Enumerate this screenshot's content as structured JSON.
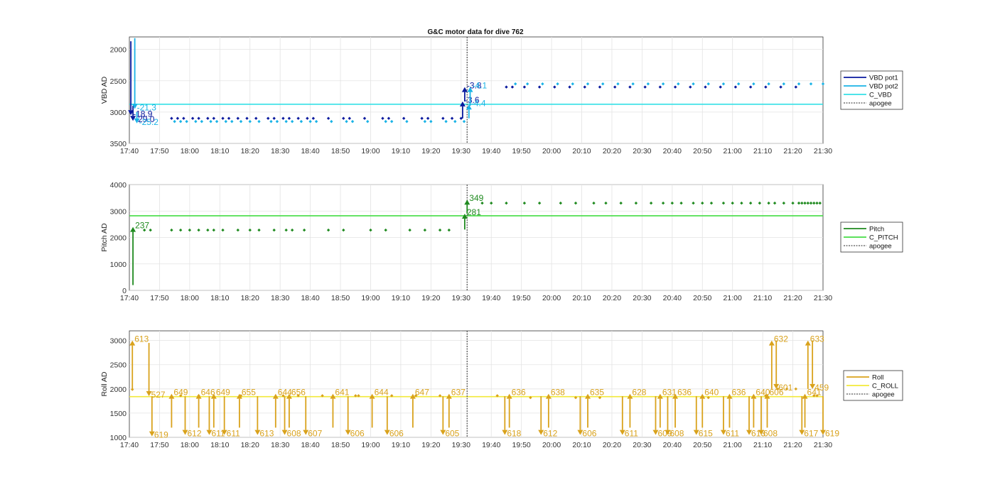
{
  "figure": {
    "title": "G&C motor data for dive 762"
  },
  "x_ticks": [
    "17:40",
    "17:50",
    "18:00",
    "18:10",
    "18:20",
    "18:30",
    "18:40",
    "18:50",
    "19:00",
    "19:10",
    "19:20",
    "19:30",
    "19:40",
    "19:50",
    "20:00",
    "20:10",
    "20:20",
    "20:30",
    "20:40",
    "20:50",
    "21:00",
    "21:10",
    "21:20",
    "21:30"
  ],
  "colors": {
    "vbd_pot1": "#0a1a9e",
    "vbd_pot2": "#1ab3e6",
    "c_vbd": "#35e0e6",
    "pitch": "#1f8a1f",
    "c_pitch": "#44dd44",
    "roll": "#d9a21c",
    "c_roll": "#f2ea3a",
    "apogee": "#555555"
  },
  "chart_data": [
    {
      "type": "scatter",
      "ylabel": "VBD AD",
      "ylim": [
        3500,
        1800
      ],
      "y_reversed": true,
      "yticks": [
        2000,
        2500,
        3000,
        3500
      ],
      "x_unit": "minutes after 17:40",
      "xlim": [
        0,
        230
      ],
      "grid": true,
      "legend_position": "right",
      "legend": [
        "VBD pot1",
        "VBD pot2",
        "C_VBD",
        "apogee"
      ],
      "apogee_x": 112,
      "reference_line": {
        "name": "C_VBD",
        "y": 2875
      },
      "series": [
        {
          "name": "VBD pot1",
          "x": [
            14,
            16,
            18,
            21,
            23,
            26,
            28,
            31,
            33,
            36,
            39,
            42,
            46,
            48,
            51,
            53,
            56,
            59,
            61,
            66,
            71,
            73,
            78,
            84,
            86,
            91,
            97,
            99,
            104,
            107,
            110,
            125,
            127,
            131,
            136,
            141,
            146,
            151,
            156,
            161,
            166,
            171,
            176,
            181,
            186,
            191,
            196,
            201,
            206,
            211,
            216,
            221
          ],
          "y": [
            3100,
            3100,
            3100,
            3100,
            3100,
            3100,
            3100,
            3100,
            3100,
            3100,
            3100,
            3100,
            3100,
            3100,
            3100,
            3100,
            3100,
            3100,
            3100,
            3100,
            3100,
            3100,
            3100,
            3100,
            3100,
            3100,
            3100,
            3100,
            3100,
            3100,
            3100,
            2600,
            2600,
            2600,
            2600,
            2600,
            2600,
            2600,
            2600,
            2600,
            2600,
            2600,
            2600,
            2600,
            2600,
            2600,
            2600,
            2600,
            2600,
            2600,
            2600,
            2600
          ]
        },
        {
          "name": "VBD pot2",
          "x": [
            15,
            17,
            19,
            22,
            24,
            27,
            29,
            32,
            34,
            37,
            40,
            43,
            47,
            49,
            52,
            54,
            57,
            60,
            62,
            67,
            72,
            74,
            79,
            85,
            87,
            92,
            98,
            100,
            105,
            108,
            111,
            128,
            132,
            137,
            142,
            147,
            152,
            157,
            162,
            167,
            172,
            177,
            182,
            187,
            192,
            197,
            202,
            207,
            212,
            217,
            222,
            226,
            230
          ],
          "y": [
            3150,
            3150,
            3150,
            3150,
            3150,
            3150,
            3150,
            3150,
            3150,
            3150,
            3150,
            3150,
            3150,
            3150,
            3150,
            3150,
            3150,
            3150,
            3150,
            3150,
            3150,
            3150,
            3150,
            3150,
            3150,
            3150,
            3150,
            3150,
            3150,
            3150,
            3150,
            2550,
            2550,
            2550,
            2550,
            2550,
            2550,
            2550,
            2550,
            2550,
            2550,
            2550,
            2550,
            2550,
            2550,
            2550,
            2550,
            2550,
            2550,
            2550,
            2550,
            2550,
            2550
          ]
        }
      ],
      "arrows": [
        {
          "series": "VBD pot1",
          "x": 0.5,
          "y_from": 1870,
          "y_to": 3050,
          "label": "-18.9"
        },
        {
          "series": "VBD pot1",
          "x": 1.2,
          "y_from": 2900,
          "y_to": 3140,
          "label": "-29.0"
        },
        {
          "series": "VBD pot2",
          "x": 1.8,
          "y_from": 1820,
          "y_to": 2950,
          "label": "-21.3"
        },
        {
          "series": "VBD pot2",
          "x": 2.5,
          "y_from": 3000,
          "y_to": 3180,
          "label": "-25.2"
        },
        {
          "series": "VBD pot1",
          "x": 110.5,
          "y_from": 3100,
          "y_to": 2830,
          "label": "-3.6"
        },
        {
          "series": "VBD pot1",
          "x": 111.2,
          "y_from": 2830,
          "y_to": 2600,
          "label": "-3.8"
        },
        {
          "series": "VBD pot2",
          "x": 112.6,
          "y_from": 3100,
          "y_to": 2880,
          "label": "-4.4"
        },
        {
          "series": "VBD pot2",
          "x": 113.0,
          "y_from": 2900,
          "y_to": 2600,
          "label": "-4.1"
        }
      ]
    },
    {
      "type": "scatter",
      "ylabel": "Pitch AD",
      "ylim": [
        0,
        4000
      ],
      "yticks": [
        0,
        1000,
        2000,
        3000,
        4000
      ],
      "x_unit": "minutes after 17:40",
      "xlim": [
        0,
        230
      ],
      "grid": true,
      "legend_position": "right",
      "legend": [
        "Pitch",
        "C_PITCH",
        "apogee"
      ],
      "apogee_x": 112,
      "reference_line": {
        "name": "C_PITCH",
        "y": 2820
      },
      "series": [
        {
          "name": "Pitch",
          "x": [
            5,
            7,
            14,
            17,
            20,
            23,
            26,
            28,
            31,
            36,
            40,
            43,
            48,
            52,
            54,
            58,
            66,
            71,
            80,
            85,
            93,
            98,
            103,
            106,
            117,
            120,
            125,
            131,
            136,
            143,
            148,
            154,
            158,
            163,
            168,
            173,
            177,
            180,
            183,
            187,
            190,
            193,
            197,
            200,
            203,
            206,
            209,
            212,
            214,
            217,
            220,
            222,
            223,
            224,
            225,
            226,
            227,
            228,
            229
          ],
          "y": [
            2280,
            2280,
            2280,
            2280,
            2280,
            2280,
            2280,
            2280,
            2280,
            2280,
            2280,
            2280,
            2280,
            2280,
            2280,
            2280,
            2280,
            2280,
            2280,
            2280,
            2280,
            2280,
            2280,
            2280,
            3300,
            3300,
            3300,
            3300,
            3300,
            3300,
            3300,
            3300,
            3300,
            3300,
            3300,
            3300,
            3300,
            3300,
            3300,
            3300,
            3300,
            3300,
            3300,
            3300,
            3300,
            3300,
            3300,
            3300,
            3300,
            3300,
            3300,
            3300,
            3300,
            3300,
            3300,
            3300,
            3300,
            3300,
            3300
          ]
        }
      ],
      "arrows": [
        {
          "series": "Pitch",
          "x": 1.2,
          "y_from": 200,
          "y_to": 2400,
          "label": "237"
        },
        {
          "series": "Pitch",
          "x": 111.2,
          "y_from": 2300,
          "y_to": 2900,
          "label": "281"
        },
        {
          "series": "Pitch",
          "x": 112.0,
          "y_from": 2900,
          "y_to": 3430,
          "label": "349"
        }
      ]
    },
    {
      "type": "scatter",
      "ylabel": "Roll AD",
      "ylim": [
        1000,
        3200
      ],
      "yticks": [
        1000,
        1500,
        2000,
        2500,
        3000
      ],
      "x_unit": "minutes after 17:40",
      "xlim": [
        0,
        230
      ],
      "grid": true,
      "legend_position": "right",
      "legend": [
        "Roll",
        "C_ROLL",
        "apogee"
      ],
      "apogee_x": 112,
      "reference_line": {
        "name": "C_ROLL",
        "y": 1840
      },
      "series": [
        {
          "name": "Roll",
          "x": [
            1,
            17,
            23,
            37,
            51,
            56,
            64,
            75,
            76,
            87,
            95,
            103,
            122,
            133,
            148,
            156,
            192,
            211,
            215,
            218,
            221,
            227,
            228
          ],
          "y": [
            1990,
            1860,
            1860,
            1860,
            1860,
            1860,
            1860,
            1860,
            1860,
            1860,
            1860,
            1860,
            1860,
            1820,
            1820,
            1820,
            1820,
            1860,
            2000,
            2000,
            2000,
            1860,
            1860
          ]
        }
      ],
      "arrows": [
        {
          "series": "Roll",
          "x": 1,
          "y_from": 1990,
          "y_to": 3000,
          "label": "613"
        },
        {
          "series": "Roll",
          "x": 6.5,
          "y_from": 2950,
          "y_to": 1850,
          "label": "527"
        },
        {
          "series": "Roll",
          "x": 7.5,
          "y_from": 1850,
          "y_to": 1020,
          "label": "619"
        },
        {
          "series": "Roll",
          "x": 14,
          "y_from": 1200,
          "y_to": 1900,
          "label": "649"
        },
        {
          "series": "Roll",
          "x": 18.5,
          "y_from": 1850,
          "y_to": 1050,
          "label": "612"
        },
        {
          "series": "Roll",
          "x": 23,
          "y_from": 1200,
          "y_to": 1900,
          "label": "646"
        },
        {
          "series": "Roll",
          "x": 26.5,
          "y_from": 1850,
          "y_to": 1050,
          "label": "611"
        },
        {
          "series": "Roll",
          "x": 28,
          "y_from": 1200,
          "y_to": 1900,
          "label": "649"
        },
        {
          "series": "Roll",
          "x": 31.5,
          "y_from": 1850,
          "y_to": 1050,
          "label": "611"
        },
        {
          "series": "Roll",
          "x": 36.5,
          "y_from": 1200,
          "y_to": 1900,
          "label": "655"
        },
        {
          "series": "Roll",
          "x": 42.5,
          "y_from": 1850,
          "y_to": 1050,
          "label": "613"
        },
        {
          "series": "Roll",
          "x": 48.5,
          "y_from": 1200,
          "y_to": 1900,
          "label": "644"
        },
        {
          "series": "Roll",
          "x": 51.5,
          "y_from": 1850,
          "y_to": 1050,
          "label": "608"
        },
        {
          "series": "Roll",
          "x": 53,
          "y_from": 1200,
          "y_to": 1900,
          "label": "656"
        },
        {
          "series": "Roll",
          "x": 58.5,
          "y_from": 1850,
          "y_to": 1050,
          "label": "607"
        },
        {
          "series": "Roll",
          "x": 67.5,
          "y_from": 1200,
          "y_to": 1900,
          "label": "641"
        },
        {
          "series": "Roll",
          "x": 72.5,
          "y_from": 1850,
          "y_to": 1050,
          "label": "606"
        },
        {
          "series": "Roll",
          "x": 80.5,
          "y_from": 1200,
          "y_to": 1900,
          "label": "644"
        },
        {
          "series": "Roll",
          "x": 85.5,
          "y_from": 1850,
          "y_to": 1050,
          "label": "606"
        },
        {
          "series": "Roll",
          "x": 94,
          "y_from": 1200,
          "y_to": 1900,
          "label": "647"
        },
        {
          "series": "Roll",
          "x": 104,
          "y_from": 1850,
          "y_to": 1050,
          "label": "605"
        },
        {
          "series": "Roll",
          "x": 106,
          "y_from": 1200,
          "y_to": 1900,
          "label": "637"
        },
        {
          "series": "Roll",
          "x": 124.5,
          "y_from": 1850,
          "y_to": 1050,
          "label": "618"
        },
        {
          "series": "Roll",
          "x": 126,
          "y_from": 1200,
          "y_to": 1900,
          "label": "636"
        },
        {
          "series": "Roll",
          "x": 136.5,
          "y_from": 1850,
          "y_to": 1050,
          "label": "612"
        },
        {
          "series": "Roll",
          "x": 139,
          "y_from": 1200,
          "y_to": 1900,
          "label": "638"
        },
        {
          "series": "Roll",
          "x": 149.5,
          "y_from": 1850,
          "y_to": 1050,
          "label": "606"
        },
        {
          "series": "Roll",
          "x": 152,
          "y_from": 1200,
          "y_to": 1900,
          "label": "635"
        },
        {
          "series": "Roll",
          "x": 163.5,
          "y_from": 1850,
          "y_to": 1050,
          "label": "611"
        },
        {
          "series": "Roll",
          "x": 166,
          "y_from": 1200,
          "y_to": 1900,
          "label": "628"
        },
        {
          "series": "Roll",
          "x": 174.5,
          "y_from": 1850,
          "y_to": 1050,
          "label": "609"
        },
        {
          "series": "Roll",
          "x": 176,
          "y_from": 1200,
          "y_to": 1900,
          "label": "631"
        },
        {
          "series": "Roll",
          "x": 178.5,
          "y_from": 1850,
          "y_to": 1050,
          "label": "608"
        },
        {
          "series": "Roll",
          "x": 181,
          "y_from": 1200,
          "y_to": 1900,
          "label": "636"
        },
        {
          "series": "Roll",
          "x": 188,
          "y_from": 1850,
          "y_to": 1050,
          "label": "615"
        },
        {
          "series": "Roll",
          "x": 190,
          "y_from": 1200,
          "y_to": 1900,
          "label": "640"
        },
        {
          "series": "Roll",
          "x": 197,
          "y_from": 1850,
          "y_to": 1050,
          "label": "611"
        },
        {
          "series": "Roll",
          "x": 199,
          "y_from": 1200,
          "y_to": 1900,
          "label": "636"
        },
        {
          "series": "Roll",
          "x": 205.5,
          "y_from": 1850,
          "y_to": 1050,
          "label": "613"
        },
        {
          "series": "Roll",
          "x": 207,
          "y_from": 1200,
          "y_to": 1900,
          "label": "640"
        },
        {
          "series": "Roll",
          "x": 209.5,
          "y_from": 1850,
          "y_to": 1050,
          "label": "608"
        },
        {
          "series": "Roll",
          "x": 211.5,
          "y_from": 1200,
          "y_to": 1900,
          "label": "606"
        },
        {
          "series": "Roll",
          "x": 213,
          "y_from": 2000,
          "y_to": 3000,
          "label": "632"
        },
        {
          "series": "Roll",
          "x": 214.5,
          "y_from": 3000,
          "y_to": 2000,
          "label": "601"
        },
        {
          "series": "Roll",
          "x": 223,
          "y_from": 1850,
          "y_to": 1050,
          "label": "617"
        },
        {
          "series": "Roll",
          "x": 224,
          "y_from": 1200,
          "y_to": 1900,
          "label": "641"
        },
        {
          "series": "Roll",
          "x": 225,
          "y_from": 2000,
          "y_to": 3000,
          "label": "633"
        },
        {
          "series": "Roll",
          "x": 226.5,
          "y_from": 3000,
          "y_to": 2000,
          "label": "459"
        },
        {
          "series": "Roll",
          "x": 230,
          "y_from": 1850,
          "y_to": 1050,
          "label": "619"
        }
      ]
    }
  ]
}
